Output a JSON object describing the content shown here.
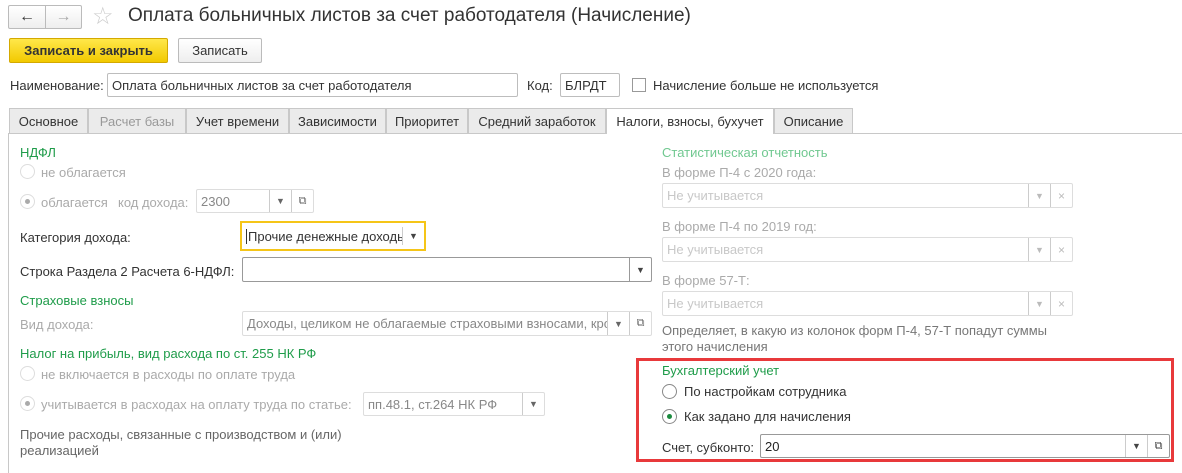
{
  "header": {
    "title": "Оплата больничных листов за счет работодателя (Начисление)",
    "back_icon": "←",
    "forward_icon": "→",
    "star_icon": "☆"
  },
  "toolbar": {
    "save_close": "Записать и закрыть",
    "save": "Записать"
  },
  "form": {
    "name_label": "Наименование:",
    "name_value": "Оплата больничных листов за счет работодателя",
    "code_label": "Код:",
    "code_value": "БЛРДТ",
    "unused_label": "Начисление больше не используется"
  },
  "tabs": [
    "Основное",
    "Расчет базы",
    "Учет времени",
    "Зависимости",
    "Приоритет",
    "Средний заработок",
    "Налоги, взносы, бухучет",
    "Описание"
  ],
  "left": {
    "ndfl_title": "НДФЛ",
    "not_taxed": "не облагается",
    "taxed": "облагается",
    "income_code_label": "код дохода:",
    "income_code": "2300",
    "income_category_label": "Категория дохода:",
    "income_category": "Прочие денежные доходы",
    "line6_label": "Строка Раздела 2 Расчета 6-НДФЛ:",
    "line6_value": "",
    "insurance_title": "Страховые взносы",
    "income_type_label": "Вид дохода:",
    "income_type": "Доходы, целиком не облагаемые страховыми взносами, кроме",
    "profit_title": "Налог на прибыль, вид расхода по ст. 255 НК РФ",
    "not_included": "не включается в расходы по оплате труда",
    "included": "учитывается в расходах на оплату труда по статье:",
    "article": "пп.48.1, ст.264 НК РФ",
    "other_expenses_1": "Прочие расходы, связанные с производством и (или)",
    "other_expenses_2": "реализацией"
  },
  "right": {
    "stats_title": "Статистическая отчетность",
    "p4_2020_label": "В форме П-4 с 2020 года:",
    "p4_2019_label": "В форме П-4 по 2019 год:",
    "f57_label": "В форме 57-Т:",
    "placeholder": "Не учитывается",
    "note_1": "Определяет, в какую из колонок форм П-4, 57-Т попадут суммы",
    "note_2": "этого начисления",
    "acc_title": "Бухгалтерский учет",
    "by_employee": "По настройкам сотрудника",
    "as_set": "Как задано для начисления",
    "account_label": "Счет, субконто:",
    "account_value": "20"
  },
  "colors": {
    "accent_green": "#1f9c4a",
    "highlight_red": "#e8393b",
    "focus_yellow": "#f5c518",
    "primary_button": "#f2c900"
  }
}
